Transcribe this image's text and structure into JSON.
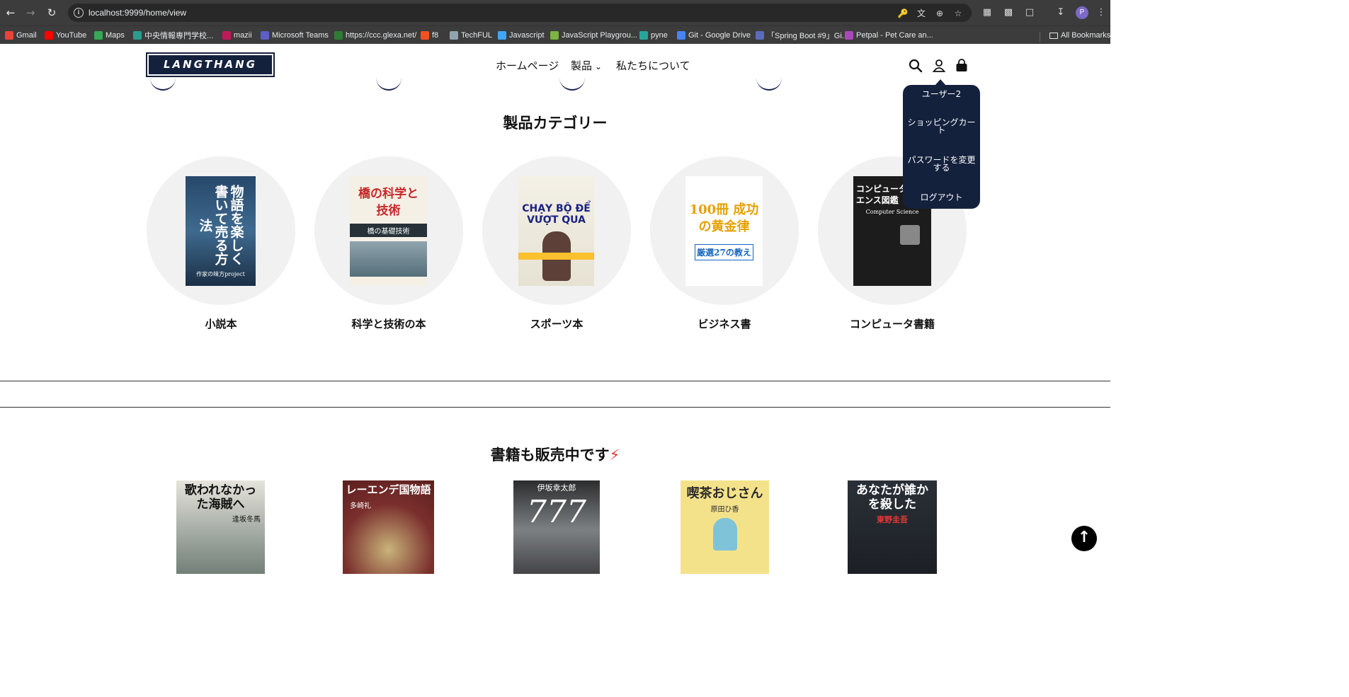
{
  "browser": {
    "url": "localhost:9999/home/view",
    "profile_initial": "P",
    "bookmarks": [
      {
        "label": "Gmail",
        "color": "#ea4335"
      },
      {
        "label": "YouTube",
        "color": "#ff0000"
      },
      {
        "label": "Maps",
        "color": "#34a853"
      },
      {
        "label": "中央情報専門学校...",
        "color": "#2a9d8f"
      },
      {
        "label": "mazii",
        "color": "#c2185b"
      },
      {
        "label": "Microsoft Teams",
        "color": "#5b5fc7"
      },
      {
        "label": "https://ccc.glexa.net/",
        "color": "#2e7d32"
      },
      {
        "label": "f8",
        "color": "#f4511e"
      },
      {
        "label": "TechFUL",
        "color": "#90a4ae"
      },
      {
        "label": "Javascript",
        "color": "#42a5f5"
      },
      {
        "label": "JavaScript Playgrou...",
        "color": "#7cb342"
      },
      {
        "label": "pyne",
        "color": "#26a69a"
      },
      {
        "label": "Git - Google Drive",
        "color": "#4285f4"
      },
      {
        "label": "「Spring Boot #9」Gi...",
        "color": "#5c6bc0"
      },
      {
        "label": "Petpal - Pet Care an...",
        "color": "#ab47bc"
      }
    ],
    "all_bookmarks": "All Bookmarks"
  },
  "header": {
    "logo_text": "LANGTHANG",
    "nav": {
      "home": "ホームページ",
      "products": "製品",
      "about": "私たちについて"
    }
  },
  "user_menu": {
    "username": "ユーザー2",
    "cart": "ショッピングカート",
    "change_password": "パスワードを変更する",
    "logout": "ログアウト"
  },
  "categories": {
    "title": "製品カテゴリー",
    "items": [
      {
        "label": "小説本",
        "cover_title": "物語を楽しく書いて売る方法",
        "cover_sub": "作家の味方project",
        "cover_color": "#1d3b59"
      },
      {
        "label": "科学と技術の本",
        "cover_title": "橋の科学と技術",
        "cover_sub": "橋の基礎技術",
        "cover_color": "#f5f0e6"
      },
      {
        "label": "スポーツ本",
        "cover_title": "CHẠY BỘ ĐỂ VƯỢT QUA",
        "cover_sub": "",
        "cover_color": "#f1eee2"
      },
      {
        "label": "ビジネス書",
        "cover_title": "100冊 成功の黄金律",
        "cover_sub": "厳選27の教え",
        "cover_color": "#ffffff"
      },
      {
        "label": "コンピュータ書籍",
        "cover_title": "コンピュータサイエンス図鑑",
        "cover_sub": "Computer Science",
        "cover_color": "#1c1c1c"
      }
    ]
  },
  "books": {
    "title": "書籍も販売中です",
    "items": [
      {
        "cover_title": "歌われなかった海賊へ",
        "cover_author": "逢坂冬馬",
        "cover_color": "#c8c7c0"
      },
      {
        "cover_title": "レーエンデ国物語",
        "cover_author": "多崎礼",
        "cover_color": "#8c3a38"
      },
      {
        "cover_title": "777",
        "cover_author": "伊坂幸太郎",
        "cover_color": "#3b3d3f"
      },
      {
        "cover_title": "喫茶おじさん",
        "cover_author": "原田ひ香",
        "cover_color": "#f4e28a"
      },
      {
        "cover_title": "あなたが誰かを殺した",
        "cover_author": "東野圭吾",
        "cover_color": "#22272d"
      }
    ]
  }
}
